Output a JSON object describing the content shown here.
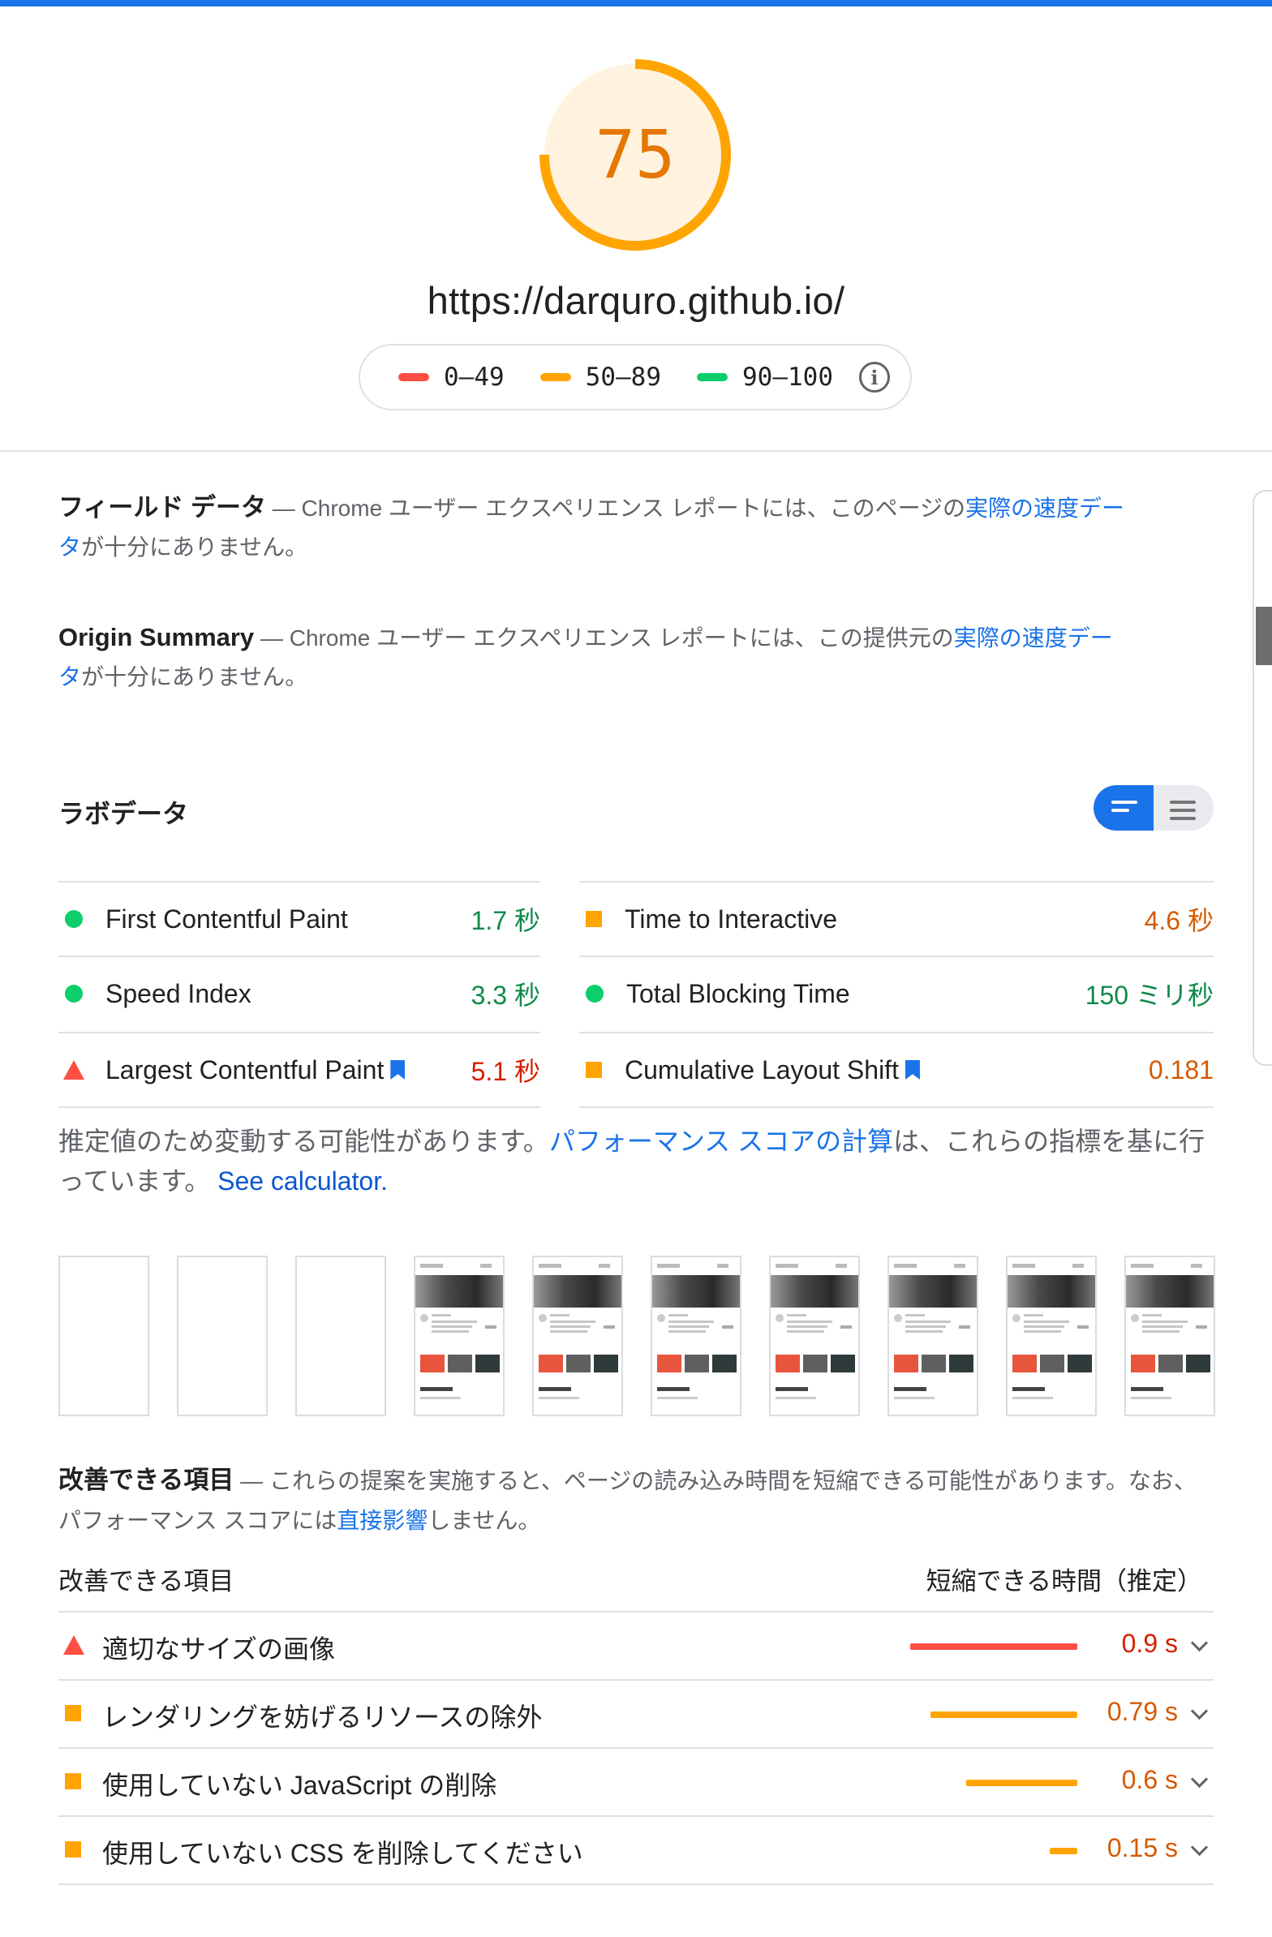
{
  "colors": {
    "accent_blue": "#1a73e8",
    "fail_red": "#ff4e42",
    "average_orange": "#ffa400",
    "pass_green": "#0cce6b",
    "gauge_fill": "#fff3e0"
  },
  "header": {
    "score": "75",
    "score_fraction": 0.75,
    "url": "https://darquro.github.io/",
    "legend": [
      {
        "label": "0–49",
        "color": "#ff4e42"
      },
      {
        "label": "50–89",
        "color": "#ffa400"
      },
      {
        "label": "90–100",
        "color": "#0cce6b"
      }
    ],
    "info_icon": "info-icon",
    "info_glyph": "i"
  },
  "field_data": {
    "title": "フィールド データ",
    "text": " — Chrome ユーザー エクスペリエンス レポートには、このページの",
    "link": "実際の速度データ",
    "text_end": "が十分にありません。"
  },
  "origin_summary": {
    "title": "Origin Summary",
    "text": " — Chrome ユーザー エクスペリエンス レポートには、この提供元の",
    "link": "実際の速度データ",
    "text_end": "が十分にありません。"
  },
  "lab_data": {
    "title": "ラボデータ",
    "toggle_icons": [
      "list-view-icon",
      "table-view-icon"
    ],
    "metrics_left": [
      {
        "label": "First Contentful Paint",
        "value": "1.7 秒",
        "status": "pass",
        "icon": "circle-icon"
      },
      {
        "label": "Speed Index",
        "value": "3.3 秒",
        "status": "pass",
        "icon": "circle-icon"
      },
      {
        "label": "Largest Contentful Paint",
        "value": "5.1 秒",
        "status": "fail",
        "icon": "triangle-icon",
        "flag": true
      }
    ],
    "metrics_right": [
      {
        "label": "Time to Interactive",
        "value": "4.6 秒",
        "status": "average",
        "icon": "square-icon"
      },
      {
        "label": "Total Blocking Time",
        "value": "150 ミリ秒",
        "status": "pass",
        "icon": "circle-icon"
      },
      {
        "label": "Cumulative Layout Shift",
        "value": "0.181",
        "status": "average",
        "icon": "square-icon",
        "flag": true
      }
    ],
    "note_text": "推定値のため変動する可能性があります。",
    "note_link": "パフォーマンス スコアの計算",
    "note_text2": "は、これらの指標を基に行っています。",
    "note_link2": "See calculator."
  },
  "filmstrip": {
    "frame_count": 10,
    "blank_frames": 3
  },
  "opportunities": {
    "title": "改善できる項目",
    "intro_text": " — これらの提案を実施すると、ページの読み込み時間を短縮できる可能性があります。なお、パフォーマンス スコアには",
    "intro_link": "直接影響",
    "intro_end": "しません。",
    "col_left": "改善できる項目",
    "col_right": "短縮できる時間（推定）",
    "items": [
      {
        "label": "適切なサイズの画像",
        "savings": "0.9 s",
        "savings_value": 0.9,
        "status": "fail"
      },
      {
        "label": "レンダリングを妨げるリソースの除外",
        "savings": "0.79 s",
        "savings_value": 0.79,
        "status": "average"
      },
      {
        "label": "使用していない JavaScript の削除",
        "savings": "0.6 s",
        "savings_value": 0.6,
        "status": "average"
      },
      {
        "label": "使用していない CSS を削除してください",
        "savings": "0.15 s",
        "savings_value": 0.15,
        "status": "average"
      }
    ]
  }
}
